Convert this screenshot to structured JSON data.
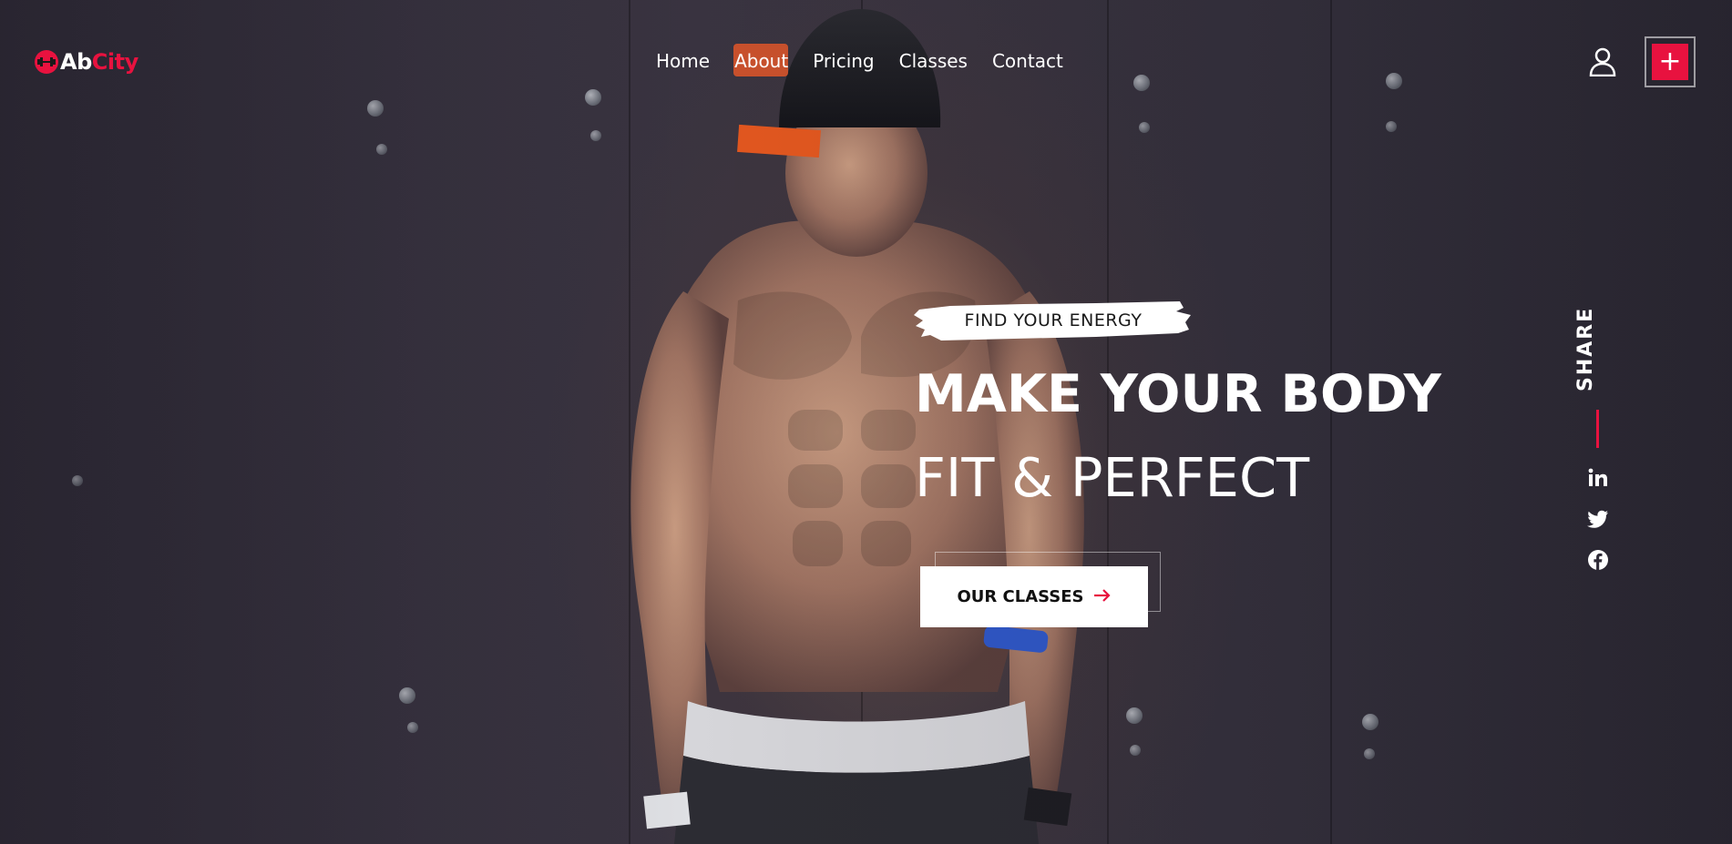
{
  "brand": {
    "name_part_1": "Ab",
    "name_part_2": "City",
    "accent_color": "#e8123f"
  },
  "nav": {
    "items": [
      {
        "label": "Home"
      },
      {
        "label": "About"
      },
      {
        "label": "Pricing"
      },
      {
        "label": "Classes"
      },
      {
        "label": "Contact"
      }
    ]
  },
  "header": {
    "user_icon": "user-icon",
    "plus_button_label": "+"
  },
  "hero": {
    "tagline": "FIND YOUR ENERGY",
    "headline_line_1": "MAKE YOUR BODY",
    "headline_line_2": "FIT & PERFECT",
    "cta_label": "OUR CLASSES",
    "cta_icon": "arrow-right-icon"
  },
  "share": {
    "label": "SHARE",
    "icons": [
      "linkedin-icon",
      "twitter-icon",
      "facebook-icon"
    ]
  }
}
